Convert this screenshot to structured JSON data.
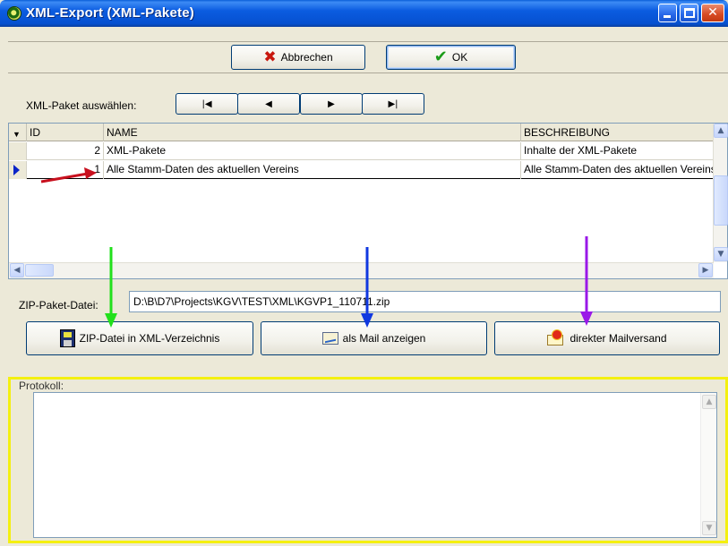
{
  "window": {
    "title": "XML-Export (XML-Pakete)",
    "icon": "app-logo-icon"
  },
  "toolbar": {
    "cancel_label": "Abbrechen",
    "ok_label": "OK"
  },
  "navigator": {
    "label": "XML-Paket auswählen:",
    "buttons": [
      {
        "name": "first",
        "glyph": "⏮",
        "icon": "first-record-icon"
      },
      {
        "name": "prior",
        "glyph": "◀",
        "icon": "prior-record-icon"
      },
      {
        "name": "next",
        "glyph": "▶",
        "icon": "next-record-icon"
      },
      {
        "name": "last",
        "glyph": "⏭",
        "icon": "last-record-icon"
      }
    ]
  },
  "grid": {
    "columns": {
      "id": "ID",
      "name": "NAME",
      "description": "BESCHREIBUNG"
    },
    "rows": [
      {
        "id": "2",
        "name": "XML-Pakete",
        "description": "Inhalte der XML-Pakete",
        "current": false
      },
      {
        "id": "1",
        "name": "Alle Stamm-Daten des aktuellen Vereins",
        "description": "Alle Stamm-Daten des aktuellen Vereins",
        "current": true
      }
    ]
  },
  "zip": {
    "label": "ZIP-Paket-Datei:",
    "value": "D:\\B\\D7\\Projects\\KGV\\TEST\\XML\\KGVP1_110711.zip"
  },
  "actions": {
    "save_to_dir": "ZIP-Datei in XML-Verzeichnis",
    "show_as_mail": "als Mail anzeigen",
    "direct_mail": "direkter Mailversand"
  },
  "protocol": {
    "label": "Protokoll:",
    "text": ""
  },
  "colors": {
    "annotation_red": "#c8101e",
    "annotation_green": "#22e01c",
    "annotation_blue": "#1038e0",
    "annotation_purple": "#9a18e8",
    "highlight_yellow": "#f4f010"
  }
}
